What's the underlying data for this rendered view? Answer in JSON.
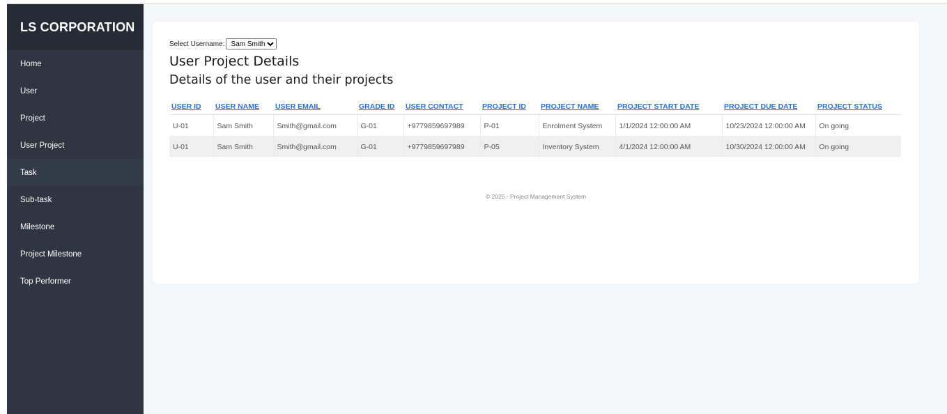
{
  "sidebar": {
    "brand": "LS CORPORATION",
    "items": [
      {
        "label": "Home"
      },
      {
        "label": "User"
      },
      {
        "label": "Project"
      },
      {
        "label": "User Project"
      },
      {
        "label": "Task"
      },
      {
        "label": "Sub-task"
      },
      {
        "label": "Milestone"
      },
      {
        "label": "Project Milestone"
      },
      {
        "label": "Top Performer"
      }
    ],
    "active_item": "Task"
  },
  "filter": {
    "label": "Select Username:",
    "selected": "Sam Smith"
  },
  "page": {
    "title": "User Project Details",
    "subtitle": "Details of the user and their projects"
  },
  "table": {
    "columns": [
      "USER ID",
      "USER NAME",
      "USER EMAIL",
      "GRADE ID",
      "USER CONTACT",
      "PROJECT ID",
      "PROJECT NAME",
      "PROJECT START DATE",
      "PROJECT DUE DATE",
      "PROJECT STATUS"
    ],
    "rows": [
      [
        "U-01",
        "Sam Smith",
        "Smith@gmail.com",
        "G-01",
        "+9779859697989",
        "P-01",
        "Enrolment System",
        "1/1/2024 12:00:00 AM",
        "10/23/2024 12:00:00 AM",
        "On going"
      ],
      [
        "U-01",
        "Sam Smith",
        "Smith@gmail.com",
        "G-01",
        "+9779859697989",
        "P-05",
        "Inventory System",
        "4/1/2024 12:00:00 AM",
        "10/30/2024 12:00:00 AM",
        "On going"
      ]
    ]
  },
  "footer": {
    "text": "© 2025 - Project Management System"
  },
  "colors": {
    "sidebar_bg": "#2f3541",
    "brand_bg": "#262b35",
    "link": "#2a6fd6",
    "content_bg": "#f4f6f9"
  }
}
